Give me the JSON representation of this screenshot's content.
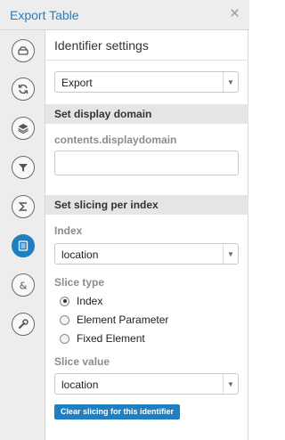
{
  "window": {
    "title": "Export Table",
    "close_glyph": "×"
  },
  "rail": {
    "accent_color": "#1f7fc0",
    "icons": [
      {
        "name": "drive-icon"
      },
      {
        "name": "refresh-icon"
      },
      {
        "name": "layers-icon"
      },
      {
        "name": "filter-icon"
      },
      {
        "name": "sigma-icon"
      },
      {
        "name": "identifier-settings-icon",
        "active": true
      },
      {
        "name": "ampersand-icon"
      },
      {
        "name": "wrench-icon"
      }
    ]
  },
  "panel": {
    "title": "Identifier settings",
    "mode_select": {
      "value": "Export",
      "arrow": "▼"
    },
    "display_domain": {
      "heading": "Set display domain",
      "label": "contents.displaydomain",
      "value": ""
    },
    "slicing": {
      "heading": "Set slicing per index",
      "index_label": "Index",
      "index_select": {
        "value": "location",
        "arrow": "▼"
      },
      "slice_type_label": "Slice type",
      "slice_types": [
        {
          "label": "Index",
          "checked": true
        },
        {
          "label": "Element Parameter",
          "checked": false
        },
        {
          "label": "Fixed Element",
          "checked": false
        }
      ],
      "slice_value_label": "Slice value",
      "slice_value_select": {
        "value": "location",
        "arrow": "▼"
      },
      "clear_button": "Clear slicing for this identifier"
    }
  }
}
